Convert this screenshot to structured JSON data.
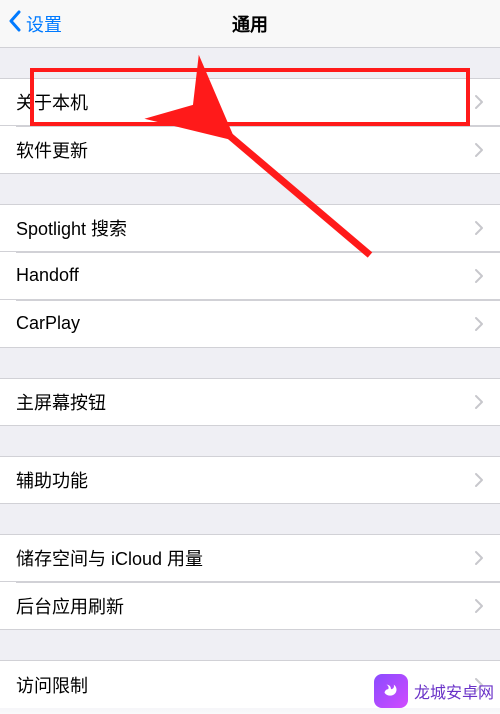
{
  "header": {
    "back_label": "设置",
    "title": "通用"
  },
  "groups": [
    {
      "items": [
        {
          "key": "about",
          "label": "关于本机"
        },
        {
          "key": "software_update",
          "label": "软件更新"
        }
      ]
    },
    {
      "items": [
        {
          "key": "spotlight",
          "label": "Spotlight 搜索"
        },
        {
          "key": "handoff",
          "label": "Handoff"
        },
        {
          "key": "carplay",
          "label": "CarPlay"
        }
      ]
    },
    {
      "items": [
        {
          "key": "home_button",
          "label": "主屏幕按钮"
        }
      ]
    },
    {
      "items": [
        {
          "key": "accessibility",
          "label": "辅助功能"
        }
      ]
    },
    {
      "items": [
        {
          "key": "storage_icloud",
          "label": "储存空间与 iCloud 用量"
        },
        {
          "key": "background_refresh",
          "label": "后台应用刷新"
        }
      ]
    },
    {
      "items": [
        {
          "key": "restrictions",
          "label": "访问限制"
        }
      ]
    }
  ],
  "annotation": {
    "highlight_target": "about",
    "highlight_color": "#ff1a1a"
  },
  "watermark": {
    "text": "龙城安卓网",
    "icon": "dragon-icon"
  }
}
